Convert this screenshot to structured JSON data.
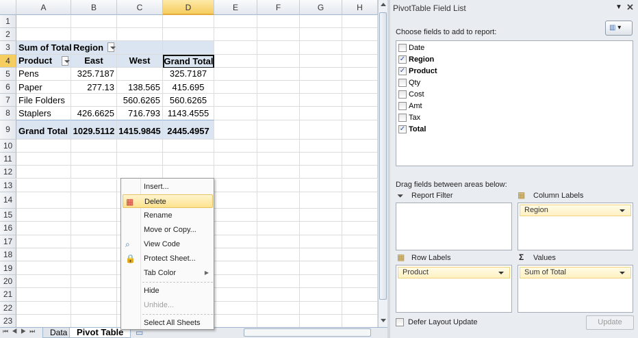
{
  "sheet": {
    "columns": [
      "A",
      "B",
      "C",
      "D",
      "E",
      "F",
      "G",
      "H"
    ],
    "selected_column": "D",
    "selected_row": "4",
    "rows": [
      "1",
      "2",
      "3",
      "4",
      "5",
      "6",
      "7",
      "8",
      "9",
      "10",
      "11",
      "12",
      "13",
      "14",
      "15",
      "16",
      "17",
      "18",
      "19",
      "20",
      "21",
      "22",
      "23"
    ],
    "pivot": {
      "values_label": "Sum of Total",
      "column_field": "Region",
      "row_field": "Product",
      "col_headers": [
        "East",
        "West",
        "Grand Total"
      ],
      "data": [
        {
          "label": "Pens",
          "east": "325.7187",
          "west": "",
          "total": "325.7187"
        },
        {
          "label": "Paper",
          "east": "277.13",
          "west": "138.565",
          "total": "415.695"
        },
        {
          "label": "File Folders",
          "east": "",
          "west": "560.6265",
          "total": "560.6265"
        },
        {
          "label": "Staplers",
          "east": "426.6625",
          "west": "716.793",
          "total": "1143.4555"
        }
      ],
      "grand_total": {
        "label": "Grand Total",
        "east": "1029.5112",
        "west": "1415.9845",
        "total": "2445.4957"
      }
    },
    "tabs": [
      {
        "label": "Data",
        "active": false
      },
      {
        "label": "Pivot Table",
        "active": true
      }
    ]
  },
  "context_menu": {
    "items": [
      {
        "label": "Insert...",
        "icon": ""
      },
      {
        "label": "Delete",
        "icon": "delete-sheet-icon",
        "highlighted": true
      },
      {
        "label": "Rename",
        "icon": ""
      },
      {
        "label": "Move or Copy...",
        "icon": ""
      },
      {
        "label": "View Code",
        "icon": "view-code-icon"
      },
      {
        "label": "Protect Sheet...",
        "icon": "lock-icon"
      },
      {
        "label": "Tab Color",
        "icon": "",
        "submenu": true
      },
      {
        "label": "Hide",
        "icon": ""
      },
      {
        "label": "Unhide...",
        "icon": "",
        "disabled": true
      },
      {
        "label": "Select All Sheets",
        "icon": ""
      }
    ]
  },
  "field_list": {
    "title": "PivotTable Field List",
    "choose_label": "Choose fields to add to report:",
    "fields": [
      {
        "name": "Date",
        "checked": false
      },
      {
        "name": "Region",
        "checked": true
      },
      {
        "name": "Product",
        "checked": true
      },
      {
        "name": "Qty",
        "checked": false
      },
      {
        "name": "Cost",
        "checked": false
      },
      {
        "name": "Amt",
        "checked": false
      },
      {
        "name": "Tax",
        "checked": false
      },
      {
        "name": "Total",
        "checked": true
      }
    ],
    "drag_label": "Drag fields between areas below:",
    "areas": {
      "report_filter": {
        "label": "Report Filter",
        "items": []
      },
      "column_labels": {
        "label": "Column Labels",
        "items": [
          "Region"
        ]
      },
      "row_labels": {
        "label": "Row Labels",
        "items": [
          "Product"
        ]
      },
      "values": {
        "label": "Values",
        "items": [
          "Sum of Total"
        ]
      }
    },
    "defer_label": "Defer Layout Update",
    "defer_checked": false,
    "update_label": "Update"
  },
  "colors": {
    "pivot_band": "#dbe5f1",
    "selection_header": "#f6cd5f",
    "menu_highlight": "#fde18d"
  }
}
